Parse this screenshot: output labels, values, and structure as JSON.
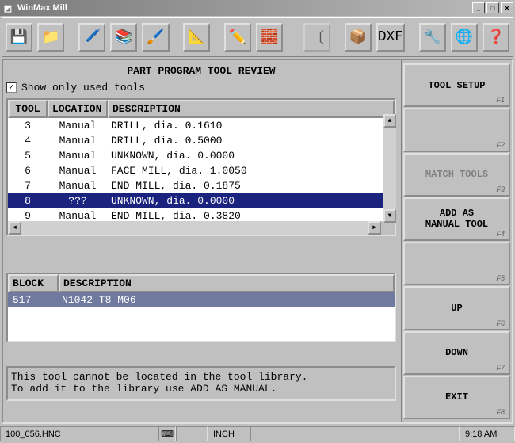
{
  "window": {
    "title": "WinMax Mill"
  },
  "heading": "PART PROGRAM TOOL REVIEW",
  "checkbox": {
    "label": "Show only used tools",
    "checked": true
  },
  "tool_table": {
    "headers": {
      "tool": "TOOL",
      "location": "LOCATION",
      "description": "DESCRIPTION"
    },
    "rows": [
      {
        "tool": "3",
        "loc": "Manual",
        "desc": "DRILL, dia. 0.1610",
        "sel": false
      },
      {
        "tool": "4",
        "loc": "Manual",
        "desc": "DRILL, dia. 0.5000",
        "sel": false
      },
      {
        "tool": "5",
        "loc": "Manual",
        "desc": "UNKNOWN, dia. 0.0000",
        "sel": false
      },
      {
        "tool": "6",
        "loc": "Manual",
        "desc": "FACE MILL, dia. 1.0050",
        "sel": false
      },
      {
        "tool": "7",
        "loc": "Manual",
        "desc": "END MILL, dia. 0.1875",
        "sel": false
      },
      {
        "tool": "8",
        "loc": "???",
        "desc": "UNKNOWN, dia. 0.0000",
        "sel": true
      },
      {
        "tool": "9",
        "loc": "Manual",
        "desc": "END MILL, dia. 0.3820",
        "sel": false
      }
    ]
  },
  "block_table": {
    "headers": {
      "block": "BLOCK",
      "description": "DESCRIPTION"
    },
    "rows": [
      {
        "block": "517",
        "desc": "N1042 T8 M06"
      }
    ]
  },
  "message": {
    "line1": "This tool cannot be located in the tool library.",
    "line2": "To add it to the library use ADD AS MANUAL."
  },
  "side_buttons": [
    {
      "label": "TOOL SETUP",
      "fk": "F1",
      "disabled": false
    },
    {
      "label": "",
      "fk": "F2",
      "disabled": true
    },
    {
      "label": "MATCH TOOLS",
      "fk": "F3",
      "disabled": true
    },
    {
      "label": "ADD AS\nMANUAL TOOL",
      "fk": "F4",
      "disabled": false
    },
    {
      "label": "",
      "fk": "F5",
      "disabled": true
    },
    {
      "label": "UP",
      "fk": "F6",
      "disabled": false
    },
    {
      "label": "DOWN",
      "fk": "F7",
      "disabled": false
    },
    {
      "label": "EXIT",
      "fk": "F8",
      "disabled": false
    }
  ],
  "toolbar_icons": [
    "open-file-icon",
    "folder-icon",
    "tool-icon",
    "library-icon",
    "tools-icon",
    "axes-icon",
    "edit-icon",
    "blocks-icon",
    "bracket-icon",
    "cube-icon",
    "dxf-icon",
    "tools2-icon",
    "globe-icon",
    "help-icon"
  ],
  "toolbar_glyphs": [
    "💾",
    "📁",
    "🖊️",
    "📚",
    "🖌️",
    "📐",
    "✏️",
    "🧱",
    "〔",
    "📦",
    "DXF",
    "🔧",
    "🌐",
    "❓"
  ],
  "statusbar": {
    "filename": "100_056.HNC",
    "units": "INCH",
    "time": "9:18 AM"
  }
}
